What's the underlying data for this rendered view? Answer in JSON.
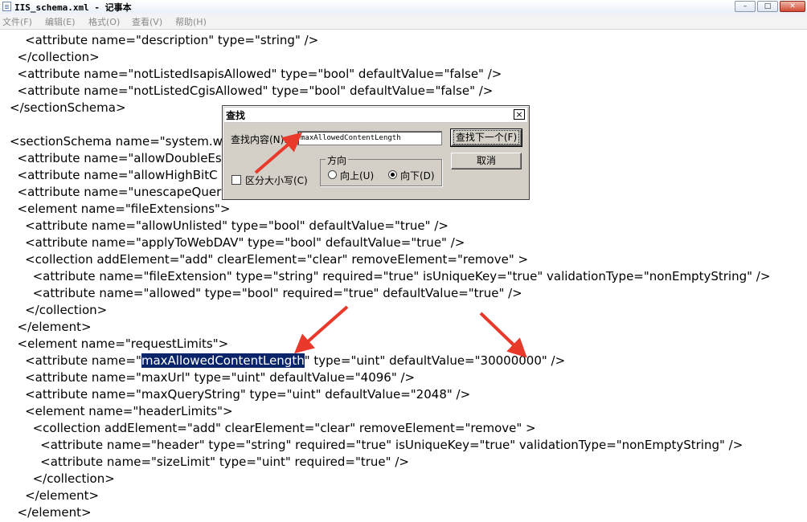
{
  "window": {
    "title": "IIS_schema.xml - 记事本",
    "minimize_label": "–",
    "maximize_label": "□",
    "close_label": "✕"
  },
  "menu": [
    "文件(F)",
    "编辑(E)",
    "格式(O)",
    "查看(V)",
    "帮助(H)"
  ],
  "editor": {
    "lines": [
      "    <attribute name=\"description\" type=\"string\" />",
      "  </collection>",
      "  <attribute name=\"notListedIsapisAllowed\" type=\"bool\" defaultValue=\"false\" />",
      "  <attribute name=\"notListedCgisAllowed\" type=\"bool\" defaultValue=\"false\" />",
      "</sectionSchema>",
      "",
      "<sectionSchema name=\"system.w",
      "  <attribute name=\"allowDoubleEs",
      "  <attribute name=\"allowHighBitC",
      "  <attribute name=\"unescapeQuer",
      "  <element name=\"fileExtensions\">",
      "    <attribute name=\"allowUnlisted\" type=\"bool\" defaultValue=\"true\" />",
      "    <attribute name=\"applyToWebDAV\" type=\"bool\" defaultValue=\"true\" />",
      "    <collection addElement=\"add\" clearElement=\"clear\" removeElement=\"remove\" >",
      "      <attribute name=\"fileExtension\" type=\"string\" required=\"true\" isUniqueKey=\"true\" validationType=\"nonEmptyString\" />",
      "      <attribute name=\"allowed\" type=\"bool\" required=\"true\" defaultValue=\"true\" />",
      "    </collection>",
      "  </element>",
      "  <element name=\"requestLimits\">",
      "",
      "    <attribute name=\"maxUrl\" type=\"uint\" defaultValue=\"4096\" />",
      "    <attribute name=\"maxQueryString\" type=\"uint\" defaultValue=\"2048\" />",
      "    <element name=\"headerLimits\">",
      "      <collection addElement=\"add\" clearElement=\"clear\" removeElement=\"remove\" >",
      "        <attribute name=\"header\" type=\"string\" required=\"true\" isUniqueKey=\"true\" validationType=\"nonEmptyString\" />",
      "        <attribute name=\"sizeLimit\" type=\"uint\" required=\"true\" />",
      "      </collection>",
      "    </element>",
      "  </element>"
    ],
    "highlight_line": {
      "prefix": "    <attribute name=\"",
      "selected": "maxAllowedContentLength",
      "suffix": "\" type=\"uint\" defaultValue=\"30000000\" />"
    }
  },
  "find_dialog": {
    "title": "查找",
    "close_label": "×",
    "find_label": "查找内容(N):",
    "find_value": "maxAllowedContentLength",
    "find_next_label": "查找下一个(F)",
    "cancel_label": "取消",
    "match_case_label": "区分大小写(C)",
    "match_case_checked": false,
    "direction_label": "方向",
    "up_label": "向上(U)",
    "down_label": "向下(D)",
    "direction": "down"
  },
  "annotation_color": "#e8392b"
}
